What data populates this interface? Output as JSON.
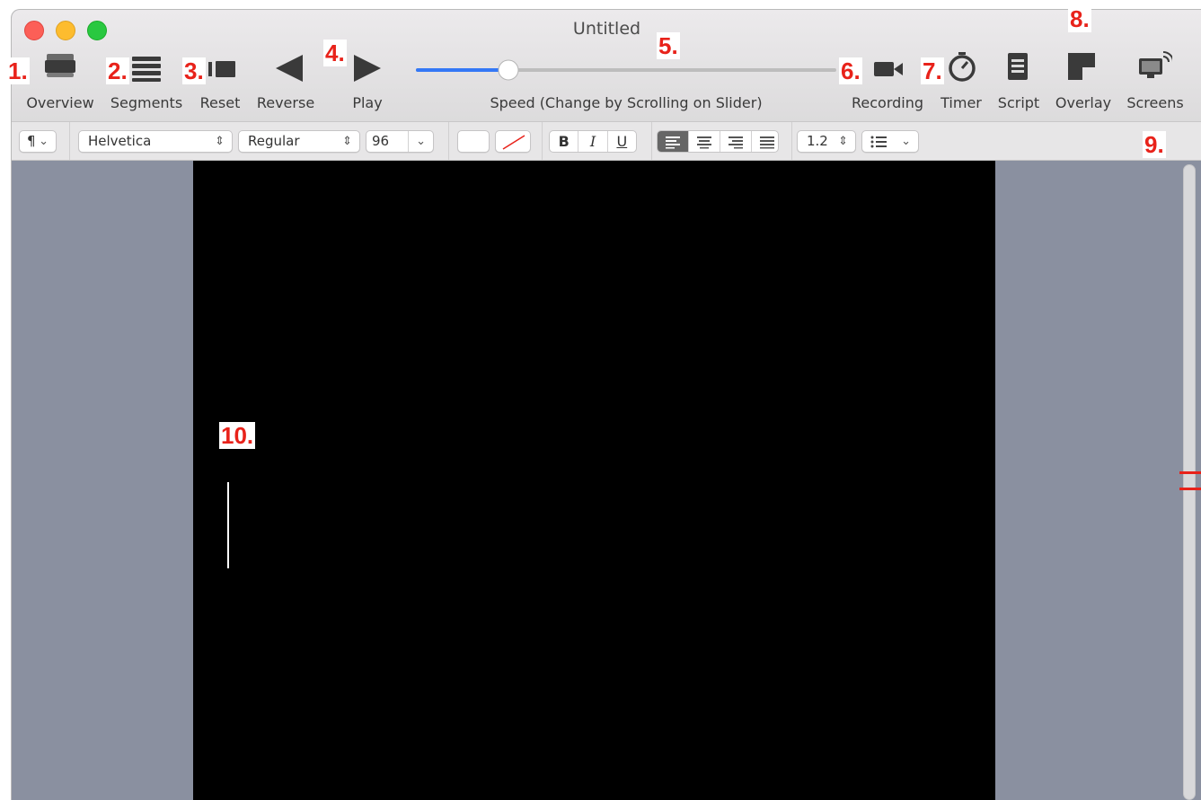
{
  "window": {
    "title": "Untitled"
  },
  "toolbar": {
    "overview": "Overview",
    "segments": "Segments",
    "reset": "Reset",
    "reverse": "Reverse",
    "play": "Play",
    "speed_label": "Speed (Change by Scrolling on Slider)",
    "speed_value_fraction": 0.22,
    "recording": "Recording",
    "timer": "Timer",
    "script": "Script",
    "overlay": "Overlay",
    "screens": "Screens"
  },
  "format": {
    "paragraph": "¶",
    "font": "Helvetica",
    "style": "Regular",
    "size": "96",
    "bold": "B",
    "italic": "I",
    "underline": "U",
    "line_spacing": "1.2"
  },
  "callouts": [
    "1.",
    "2.",
    "3.",
    "4.",
    "5.",
    "6.",
    "7.",
    "8.",
    "9.",
    "10."
  ],
  "colors": {
    "accent": "#3478f6",
    "callout": "#e8221a",
    "canvas": "#000000"
  }
}
